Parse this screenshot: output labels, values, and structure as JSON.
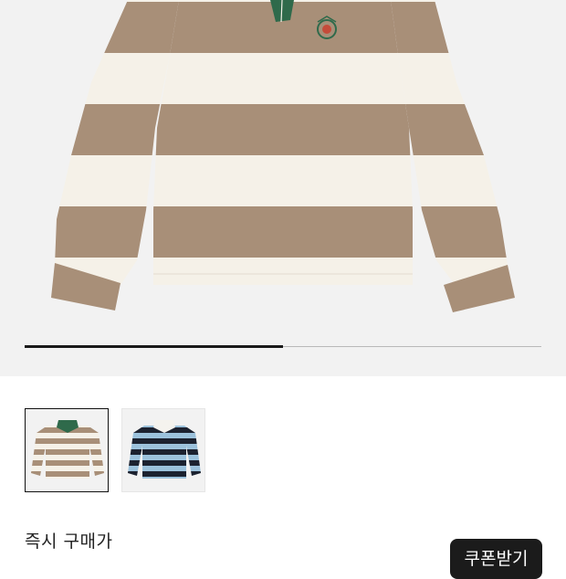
{
  "product_image": {
    "stripe_primary": "#a88f78",
    "stripe_secondary": "#f5f1e8",
    "collar_color": "#2f6a4b"
  },
  "gallery": {
    "progress": 0.5,
    "thumbnails": [
      {
        "name": "beige-stripe-rugby",
        "stripe_a": "#a88f78",
        "stripe_b": "#f5f1e8",
        "collar": "#2f6a4b",
        "selected": true
      },
      {
        "name": "blue-black-stripe-rugby",
        "stripe_a": "#1c2230",
        "stripe_b": "#9cc2dc",
        "collar": "#f5f3ee",
        "selected": false
      }
    ]
  },
  "purchase": {
    "price_label": "즉시 구매가",
    "coupon_button": "쿠폰받기"
  },
  "colors": {
    "button_bg": "#1b1b1b",
    "progress_active": "#1a1a1a",
    "progress_track": "#b9b9b9"
  }
}
